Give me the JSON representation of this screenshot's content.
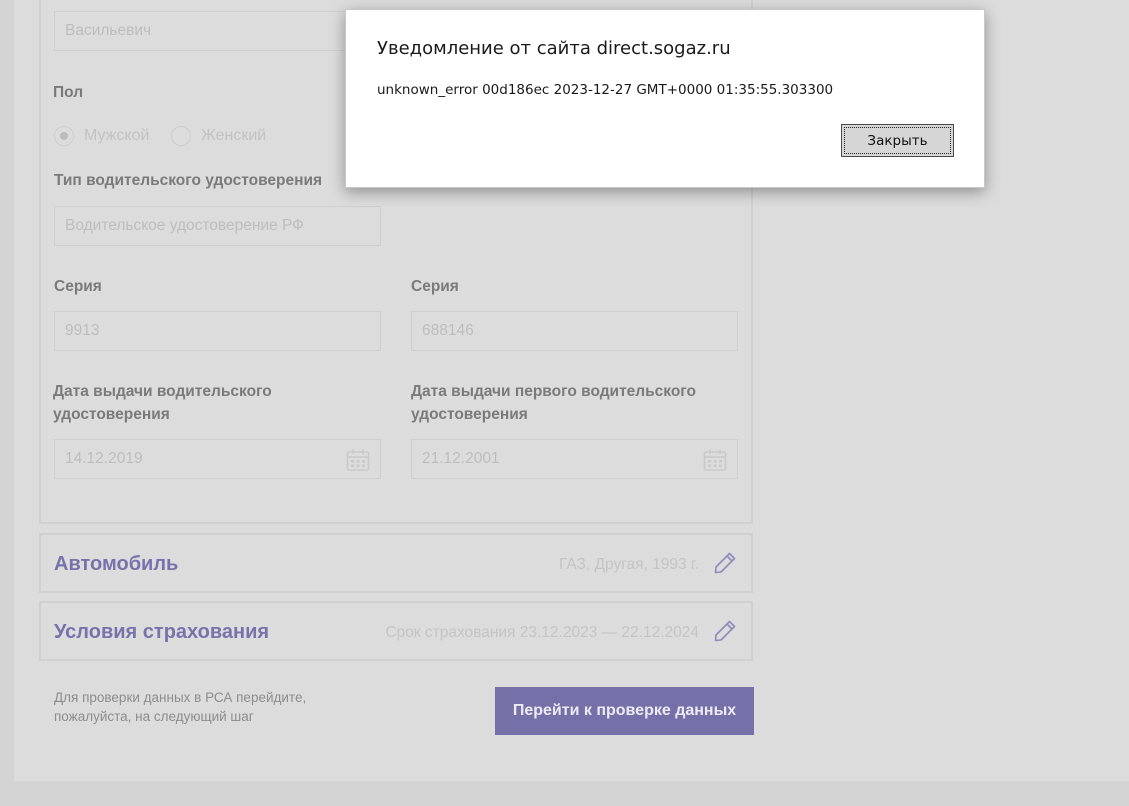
{
  "driver": {
    "patronymic_value": "Васильевич",
    "gender_label": "Пол",
    "gender_options": [
      "Мужской",
      "Женский"
    ],
    "license_type_label": "Тип водительского удостоверения",
    "license_type_value": "Водительское удостоверение РФ",
    "series_label_1": "Серия",
    "series_value_1": "9913",
    "series_label_2": "Серия",
    "series_value_2": "688146",
    "issue_date_label": "Дата выдачи водительского удостоверения",
    "issue_date_value": "14.12.2019",
    "first_issue_date_label": "Дата выдачи первого водительского удостоверения",
    "first_issue_date_value": "21.12.2001"
  },
  "sections": {
    "car": {
      "title": "Автомобиль",
      "summary": "ГАЗ, Другая, 1993 г."
    },
    "insurance": {
      "title": "Условия страхования",
      "summary": "Срок страхования 23.12.2023 — 22.12.2024"
    }
  },
  "footer": {
    "hint": "Для проверки данных в РСА перейдите, пожалуйста, на следующий шаг",
    "next_button": "Перейти к проверке данных"
  },
  "dialog": {
    "title": "Уведомление от сайта direct.sogaz.ru",
    "message": "unknown_error 00d186ec 2023-12-27 GMT+0000 01:35:55.303300",
    "close_button": "Закрыть"
  },
  "colors": {
    "accent": "#7670a9",
    "section_title": "#7872ac",
    "overlay_background": "#dcdcdc"
  }
}
